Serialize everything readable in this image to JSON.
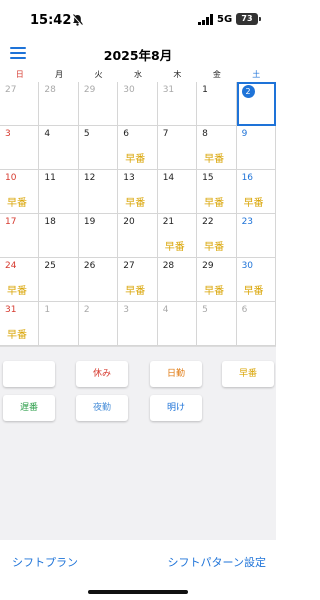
{
  "status_bar": {
    "time": "15:42",
    "network": "5G",
    "battery": "73"
  },
  "header": {
    "title": "2025年8月"
  },
  "colors": {
    "accent": "#1e73d8",
    "sunday": "#d63a2f",
    "saturday": "#1e73d8",
    "weekday": "#222222",
    "other_month": "#a9a9a9",
    "shift_text": "#d9a404"
  },
  "weekdays": [
    {
      "label": "日",
      "color": "#d63a2f"
    },
    {
      "label": "月",
      "color": "#222222"
    },
    {
      "label": "火",
      "color": "#222222"
    },
    {
      "label": "水",
      "color": "#222222"
    },
    {
      "label": "木",
      "color": "#222222"
    },
    {
      "label": "金",
      "color": "#222222"
    },
    {
      "label": "土",
      "color": "#1e73d8"
    }
  ],
  "weeks": [
    [
      {
        "day": "27",
        "other": true,
        "shift": ""
      },
      {
        "day": "28",
        "other": true,
        "shift": ""
      },
      {
        "day": "29",
        "other": true,
        "shift": ""
      },
      {
        "day": "30",
        "other": true,
        "shift": ""
      },
      {
        "day": "31",
        "other": true,
        "shift": ""
      },
      {
        "day": "1",
        "other": false,
        "shift": ""
      },
      {
        "day": "2",
        "other": false,
        "shift": "",
        "selected": true
      }
    ],
    [
      {
        "day": "3",
        "other": false,
        "shift": ""
      },
      {
        "day": "4",
        "other": false,
        "shift": ""
      },
      {
        "day": "5",
        "other": false,
        "shift": ""
      },
      {
        "day": "6",
        "other": false,
        "shift": "早番"
      },
      {
        "day": "7",
        "other": false,
        "shift": ""
      },
      {
        "day": "8",
        "other": false,
        "shift": "早番"
      },
      {
        "day": "9",
        "other": false,
        "shift": ""
      }
    ],
    [
      {
        "day": "10",
        "other": false,
        "shift": "早番"
      },
      {
        "day": "11",
        "other": false,
        "shift": ""
      },
      {
        "day": "12",
        "other": false,
        "shift": ""
      },
      {
        "day": "13",
        "other": false,
        "shift": "早番"
      },
      {
        "day": "14",
        "other": false,
        "shift": ""
      },
      {
        "day": "15",
        "other": false,
        "shift": "早番"
      },
      {
        "day": "16",
        "other": false,
        "shift": "早番"
      }
    ],
    [
      {
        "day": "17",
        "other": false,
        "shift": ""
      },
      {
        "day": "18",
        "other": false,
        "shift": ""
      },
      {
        "day": "19",
        "other": false,
        "shift": ""
      },
      {
        "day": "20",
        "other": false,
        "shift": ""
      },
      {
        "day": "21",
        "other": false,
        "shift": "早番"
      },
      {
        "day": "22",
        "other": false,
        "shift": "早番"
      },
      {
        "day": "23",
        "other": false,
        "shift": ""
      }
    ],
    [
      {
        "day": "24",
        "other": false,
        "shift": "早番"
      },
      {
        "day": "25",
        "other": false,
        "shift": ""
      },
      {
        "day": "26",
        "other": false,
        "shift": ""
      },
      {
        "day": "27",
        "other": false,
        "shift": "早番"
      },
      {
        "day": "28",
        "other": false,
        "shift": ""
      },
      {
        "day": "29",
        "other": false,
        "shift": "早番"
      },
      {
        "day": "30",
        "other": false,
        "shift": "早番"
      }
    ],
    [
      {
        "day": "31",
        "other": false,
        "shift": "早番"
      },
      {
        "day": "1",
        "other": true,
        "shift": ""
      },
      {
        "day": "2",
        "other": true,
        "shift": ""
      },
      {
        "day": "3",
        "other": true,
        "shift": ""
      },
      {
        "day": "4",
        "other": true,
        "shift": ""
      },
      {
        "day": "5",
        "other": true,
        "shift": ""
      },
      {
        "day": "6",
        "other": true,
        "shift": ""
      }
    ]
  ],
  "shift_buttons": [
    {
      "label": "",
      "color": "#222222"
    },
    {
      "label": "休み",
      "color": "#d63a2f"
    },
    {
      "label": "日勤",
      "color": "#e07b13"
    },
    {
      "label": "早番",
      "color": "#d9a404"
    },
    {
      "label": "遅番",
      "color": "#2e9f4b"
    },
    {
      "label": "夜勤",
      "color": "#4a8fd8"
    },
    {
      "label": "明け",
      "color": "#1e73d8"
    }
  ],
  "bottom_bar": {
    "left_label": "シフトプラン",
    "right_label": "シフトパターン設定"
  }
}
